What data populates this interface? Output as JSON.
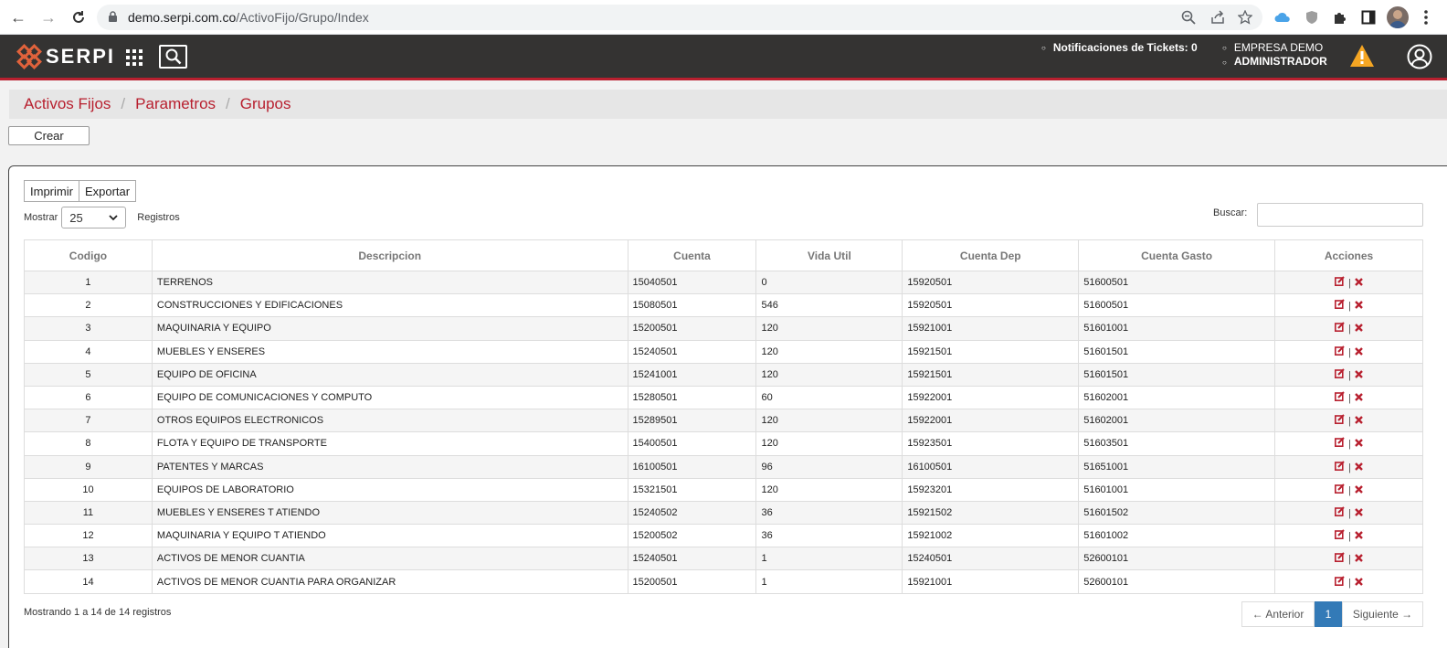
{
  "browser": {
    "host": "demo.serpi.com.co",
    "path": "/ActivoFijo/Grupo/Index"
  },
  "header": {
    "logo_text": "SERPI",
    "notifications": "Notificaciones de Tickets: 0",
    "company": "EMPRESA DEMO",
    "role": "ADMINISTRADOR"
  },
  "breadcrumb": [
    "Activos Fijos",
    "Parametros",
    "Grupos"
  ],
  "actions": {
    "create_label": "Crear",
    "print_label": "Imprimir",
    "export_label": "Exportar"
  },
  "length": {
    "before": "Mostrar",
    "value": "25",
    "after": "Registros"
  },
  "search": {
    "label": "Buscar:",
    "value": ""
  },
  "table": {
    "columns": [
      "Codigo",
      "Descripcion",
      "Cuenta",
      "Vida Util",
      "Cuenta Dep",
      "Cuenta Gasto",
      "Acciones"
    ],
    "rows": [
      [
        "1",
        "TERRENOS",
        "15040501",
        "0",
        "15920501",
        "51600501"
      ],
      [
        "2",
        "CONSTRUCCIONES Y EDIFICACIONES",
        "15080501",
        "546",
        "15920501",
        "51600501"
      ],
      [
        "3",
        "MAQUINARIA Y EQUIPO",
        "15200501",
        "120",
        "15921001",
        "51601001"
      ],
      [
        "4",
        "MUEBLES Y ENSERES",
        "15240501",
        "120",
        "15921501",
        "51601501"
      ],
      [
        "5",
        "EQUIPO DE OFICINA",
        "15241001",
        "120",
        "15921501",
        "51601501"
      ],
      [
        "6",
        "EQUIPO DE COMUNICACIONES Y COMPUTO",
        "15280501",
        "60",
        "15922001",
        "51602001"
      ],
      [
        "7",
        "OTROS EQUIPOS ELECTRONICOS",
        "15289501",
        "120",
        "15922001",
        "51602001"
      ],
      [
        "8",
        "FLOTA Y EQUIPO DE TRANSPORTE",
        "15400501",
        "120",
        "15923501",
        "51603501"
      ],
      [
        "9",
        "PATENTES Y MARCAS",
        "16100501",
        "96",
        "16100501",
        "51651001"
      ],
      [
        "10",
        "EQUIPOS DE LABORATORIO",
        "15321501",
        "120",
        "15923201",
        "51601001"
      ],
      [
        "11",
        "MUEBLES Y ENSERES T ATIENDO",
        "15240502",
        "36",
        "15921502",
        "51601502"
      ],
      [
        "12",
        "MAQUINARIA Y EQUIPO T ATIENDO",
        "15200502",
        "36",
        "15921002",
        "51601002"
      ],
      [
        "13",
        "ACTIVOS DE MENOR CUANTIA",
        "15240501",
        "1",
        "15240501",
        "52600101"
      ],
      [
        "14",
        "ACTIVOS DE MENOR CUANTIA PARA ORGANIZAR",
        "15200501",
        "1",
        "15921001",
        "52600101"
      ]
    ]
  },
  "info": "Mostrando 1 a 14 de 14 registros",
  "pager": {
    "prev": "← Anterior",
    "current": "1",
    "next": "Siguiente →"
  },
  "colors": {
    "brand": "#b8202f",
    "header_bg": "#343332",
    "pager_active": "#337ab7"
  }
}
